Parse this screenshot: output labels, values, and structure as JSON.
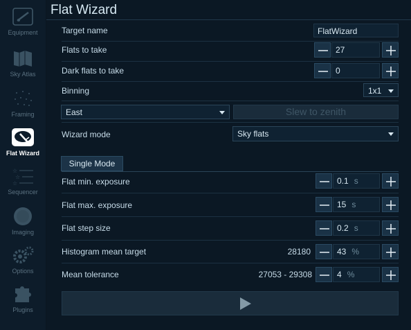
{
  "sidebar": {
    "items": [
      {
        "label": "Equipment",
        "icon": "telescope-icon",
        "active": false
      },
      {
        "label": "Sky Atlas",
        "icon": "map-icon",
        "active": false
      },
      {
        "label": "Framing",
        "icon": "dots-icon",
        "active": false
      },
      {
        "label": "Flat Wizard",
        "icon": "flat-wizard-icon",
        "active": true
      },
      {
        "label": "Sequencer",
        "icon": "sequencer-stars-icon",
        "active": false
      },
      {
        "label": "Imaging",
        "icon": "imaging-icon",
        "active": false
      },
      {
        "label": "Options",
        "icon": "gears-icon",
        "active": false
      },
      {
        "label": "Plugins",
        "icon": "puzzle-icon",
        "active": false
      }
    ]
  },
  "page": {
    "title": "Flat Wizard",
    "target_name_label": "Target name",
    "target_name_value": "FlatWizard",
    "flats_label": "Flats to take",
    "flats_value": "27",
    "dark_flats_label": "Dark flats to take",
    "dark_flats_value": "0",
    "binning_label": "Binning",
    "binning_value": "1x1",
    "direction_value": "East",
    "slew_label": "Slew to zenith",
    "wizard_mode_label": "Wizard mode",
    "wizard_mode_value": "Sky flats",
    "mode_tab_label": "Single Mode",
    "min_exposure_label": "Flat min. exposure",
    "min_exposure_value": "0.1",
    "min_exposure_unit": "s",
    "max_exposure_label": "Flat max. exposure",
    "max_exposure_value": "15",
    "max_exposure_unit": "s",
    "step_size_label": "Flat step size",
    "step_size_value": "0.2",
    "step_size_unit": "s",
    "histogram_label": "Histogram mean target",
    "histogram_adu": "28180",
    "histogram_value": "43",
    "histogram_unit": "%",
    "tolerance_label": "Mean tolerance",
    "tolerance_range": "27053 - 29308",
    "tolerance_value": "4",
    "tolerance_unit": "%"
  },
  "colors": {
    "background": "#0b1824",
    "accent": "#1a3246",
    "text": "#c6dbe8"
  }
}
